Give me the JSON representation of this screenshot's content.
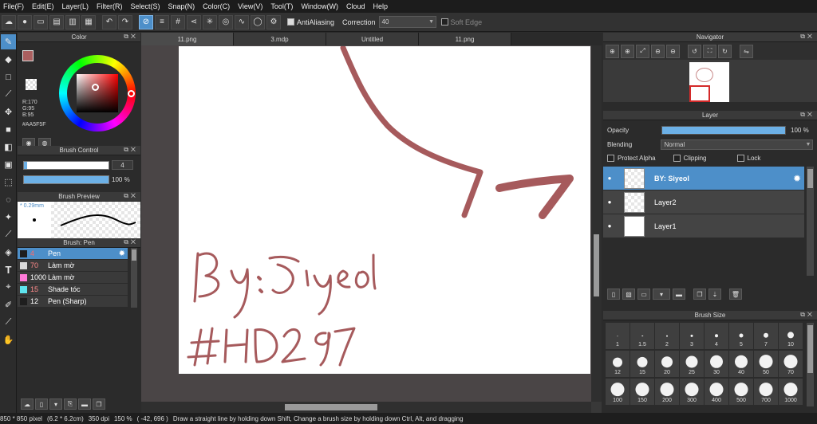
{
  "menu": [
    "File(F)",
    "Edit(E)",
    "Layer(L)",
    "Filter(R)",
    "Select(S)",
    "Snap(N)",
    "Color(C)",
    "View(V)",
    "Tool(T)",
    "Window(W)",
    "Cloud",
    "Help"
  ],
  "toolbar": {
    "antialiasing_label": "AntiAliasing",
    "correction_label": "Correction",
    "correction_value": "40",
    "soft_edge_label": "Soft Edge"
  },
  "color_panel": {
    "title": "Color",
    "rgb_r": "R:170",
    "rgb_g": "G:95",
    "rgb_b": "B:95",
    "hex": "#AA5F5F",
    "current_color": "#aa5f5f"
  },
  "brush_control": {
    "title": "Brush Control",
    "size_value": "4",
    "opacity_value": "100 %"
  },
  "brush_preview": {
    "title": "Brush Preview",
    "size_label": "* 0.29mm"
  },
  "brush_list": {
    "title": "Brush: Pen",
    "items": [
      {
        "num": "4",
        "name": "Pen",
        "color": "#1e1e1e",
        "num_color": "#ff6a6a"
      },
      {
        "num": "70",
        "name": "Làm mờ",
        "color": "#d9d9d9",
        "num_color": "#ff8a8a"
      },
      {
        "num": "1000",
        "name": "Làm mờ",
        "color": "#ff7ad9",
        "num_color": "#ffffff"
      },
      {
        "num": "15",
        "name": "Shade tóc",
        "color": "#5ee4ee",
        "num_color": "#ff8a8a"
      },
      {
        "num": "12",
        "name": "Pen (Sharp)",
        "color": "#1e1e1e",
        "num_color": "#ffffff"
      }
    ]
  },
  "tabs": [
    "11.png",
    "3.mdp",
    "Untitled",
    "11.png"
  ],
  "navigator": {
    "title": "Navigator"
  },
  "layer_panel": {
    "title": "Layer",
    "opacity_label": "Opacity",
    "opacity_value": "100 %",
    "blending_label": "Blending",
    "blending_value": "Normal",
    "protect_alpha": "Protect Alpha",
    "clipping": "Clipping",
    "lock": "Lock",
    "layers": [
      "BY: Siyeol",
      "Layer2",
      "Layer1"
    ]
  },
  "brush_size": {
    "title": "Brush Size",
    "sizes": [
      "1",
      "1.5",
      "2",
      "3",
      "4",
      "5",
      "7",
      "10",
      "12",
      "15",
      "20",
      "25",
      "30",
      "40",
      "50",
      "70",
      "100",
      "150",
      "200",
      "300",
      "400",
      "500",
      "700",
      "1000"
    ]
  },
  "status": {
    "size": "850 * 850 pixel",
    "cm": "(6.2 * 6.2cm)",
    "dpi": "350 dpi",
    "zoom": "150 %",
    "coords": "( -42, 696 )",
    "hint": "Draw a straight line by holding down Shift, Change a brush size by holding down Ctrl, Alt, and dragging"
  }
}
